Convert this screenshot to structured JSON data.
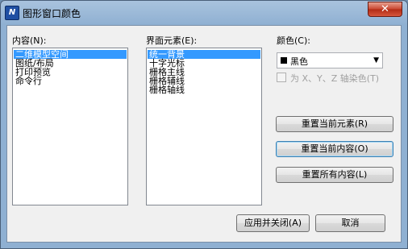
{
  "window": {
    "title": "图形窗口颜色",
    "close_glyph": "✕",
    "app_icon_glyph": "N"
  },
  "content": {
    "label": "内容(N):",
    "items": [
      "二维模型空间",
      "图纸/布局",
      "打印预览",
      "命令行"
    ]
  },
  "elements": {
    "label": "界面元素(E):",
    "items": [
      "统一背景",
      "十字光标",
      "栅格主线",
      "栅格辅线",
      "栅格轴线"
    ]
  },
  "color": {
    "label": "颜色(C):",
    "selected": "黑色",
    "swatch": "#000000",
    "tint_checkbox_label": "为 X、Y、Z 轴染色(T)"
  },
  "buttons": {
    "reset_element": "重置当前元素(R)",
    "reset_context": "重置当前内容(O)",
    "reset_all": "重置所有内容(L)",
    "apply_close": "应用并关闭(A)",
    "cancel": "取消"
  }
}
